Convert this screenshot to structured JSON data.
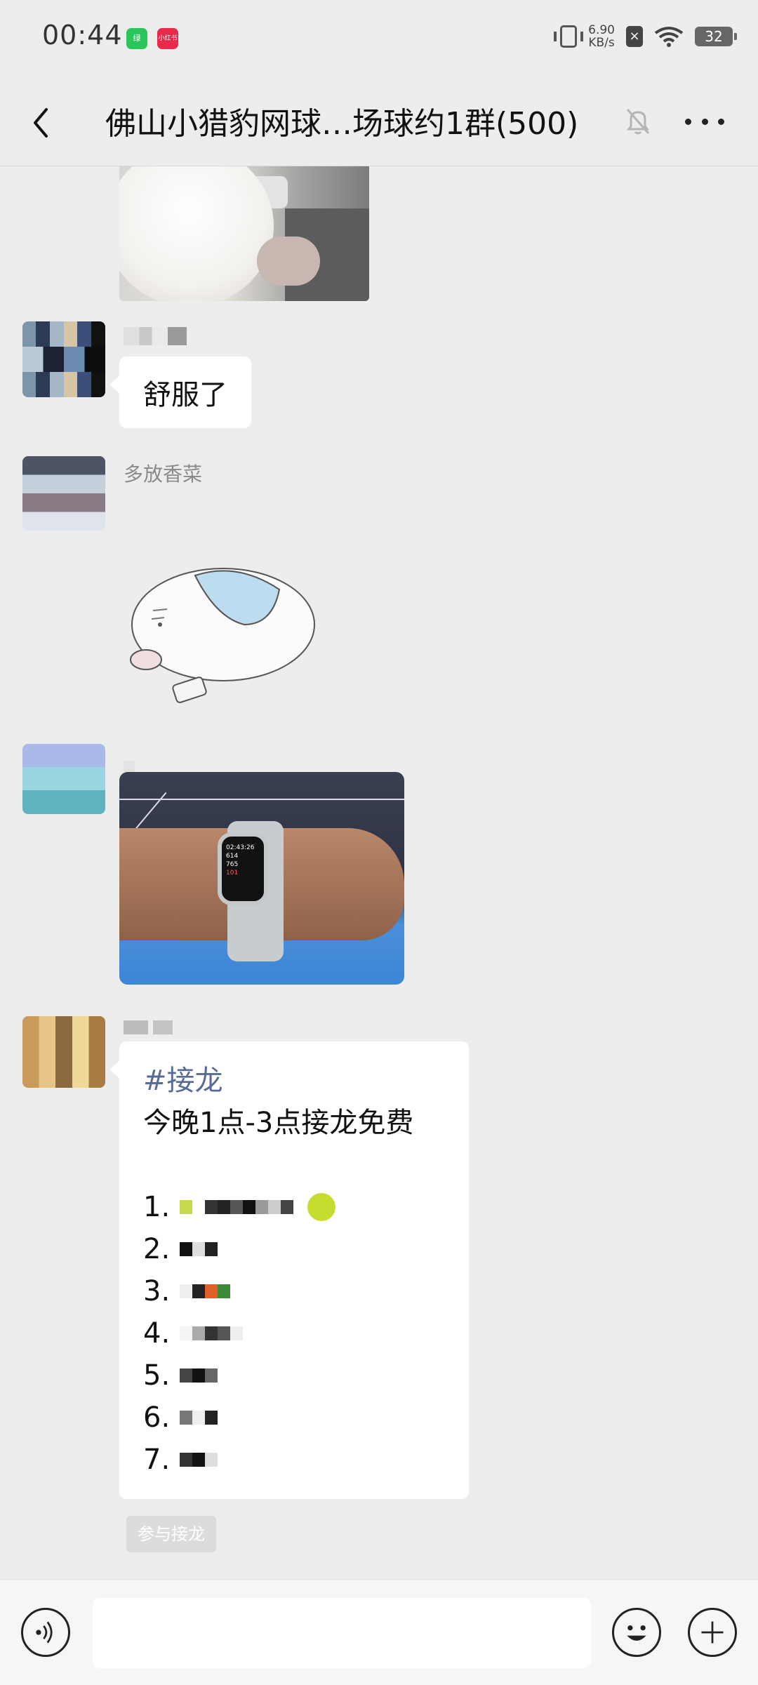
{
  "status_bar": {
    "time": "00:44",
    "app1": "绿",
    "app2": "小红书",
    "speed_top": "6.90",
    "speed_bottom": "KB/s",
    "battery": "32"
  },
  "header": {
    "title": "佛山小猎豹网球…场球约1群(500)"
  },
  "messages": [
    {
      "type": "image",
      "description_icon": "dog-photo"
    },
    {
      "type": "text",
      "nickname": "",
      "text": "舒服了"
    },
    {
      "type": "sticker",
      "nickname": "多放香菜",
      "description_icon": "hamster-sticker"
    },
    {
      "type": "image",
      "nickname": "",
      "description_icon": "smartwatch-photo"
    },
    {
      "type": "solitaire",
      "tag": "#接龙",
      "line": "今晚1点-3点接龙免费",
      "items": [
        "1.",
        "2.",
        "3.",
        "4.",
        "5.",
        "6.",
        "7."
      ]
    }
  ],
  "solitaire_button": "参与接龙",
  "watch": {
    "line1": "02:43:26",
    "line2": "614",
    "line3": "765",
    "line4": "101"
  },
  "colors": {
    "background": "#ededed",
    "bubble": "#ffffff",
    "tag": "#576b95"
  }
}
